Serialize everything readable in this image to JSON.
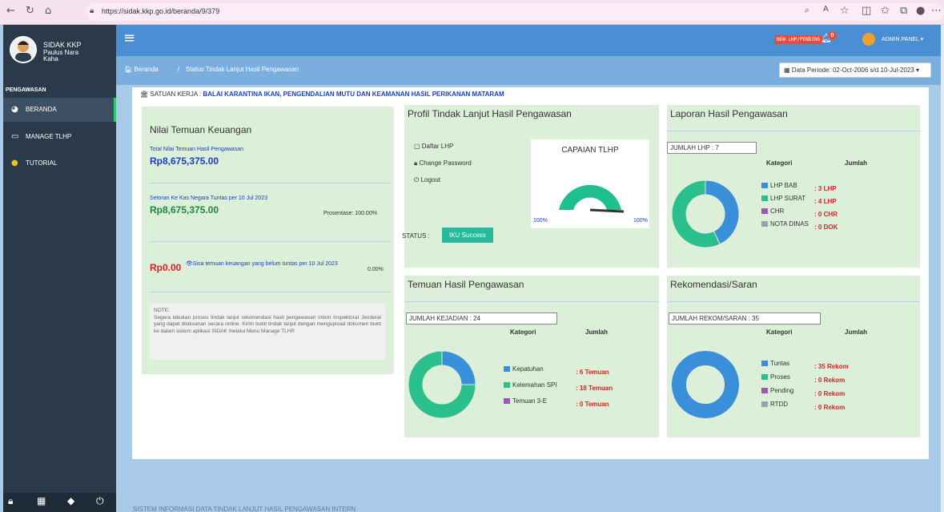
{
  "browser": {
    "url": "https://sidak.kkp.go.id/beranda/9/379"
  },
  "sidebar": {
    "app": "SIDAK KKP",
    "user_line1": "Paulus Nara",
    "user_line2": "Kaha",
    "section": "PENGAWASAN",
    "items": [
      {
        "label": "BERANDA"
      },
      {
        "label": "MANAGE TLHP"
      },
      {
        "label": "TUTORIAL"
      }
    ]
  },
  "topbar": {
    "badge": "NEW LHP/PENDING",
    "notif_count": "0",
    "admin": "ADMIN PANEL"
  },
  "breadcrumb": {
    "home": "Beranda",
    "sep": "/",
    "current": "Status Tindak Lanjut Hasil Pengawasan",
    "period": "Data Periode: 02-Oct-2006 s/d 10-Jul-2023"
  },
  "satuan": {
    "label": "SATUAN KERJA :",
    "value": "BALAI KARANTINA IKAN, PENGENDALIAN MUTU DAN KEAMANAN HASIL PERIKANAN MATARAM"
  },
  "nilai": {
    "title": "Nilai Temuan Keuangan",
    "total_label": "Total Nilai Temuan Hasil Pengawasan",
    "total_value": "Rp8,675,375.00",
    "setoran_label": "Setoran Ke Kas Negara Tuntas per 10 Jul 2023",
    "setoran_value": "Rp8,675,375.00",
    "prosentase": "Prosentase: 100.00%",
    "sisa_value": "Rp0.00",
    "sisa_label": "Sisa temuan keuangan yang belum tuntas per 10 Jul 2023",
    "sisa_pct": "0.00%",
    "note": "NOTE:\nSegera lakukan proses tindak lanjut rekomendasi hasil pengawasan intern Inspektorat Jenderal yang dapat dilaksanan secara online. Kirim bukti tindak lanjut dengan mengupload dokumen bukti ke dalam sistem aplikasi SIDAK melalui Menu Manage TLHP."
  },
  "profil": {
    "title": "Profil Tindak Lanjut Hasil Pengawasan",
    "links": [
      "Daftar LHP",
      "Change Password",
      "Logout"
    ],
    "status_label": "STATUS :",
    "status_value": "IKU Success"
  },
  "capaian": {
    "title": "CAPAIAN TLHP",
    "left": "100%",
    "right": "100%",
    "value": 100
  },
  "laporan": {
    "title": "Laporan Hasil Pengawasan",
    "box": "JUMLAH LHP : 7",
    "col1": "Kategori",
    "col2": "Jumlah",
    "rows": [
      {
        "label": "LHP BAB",
        "value": "3 LHP",
        "color": "#3a8fd9",
        "num": 3
      },
      {
        "label": "LHP SURAT",
        "value": "4 LHP",
        "color": "#2bbf8e",
        "num": 4
      },
      {
        "label": "CHR",
        "value": "0 CHR",
        "color": "#9b59b6",
        "num": 0
      },
      {
        "label": "NOTA DINAS",
        "value": "0 DOK",
        "color": "#95a5a6",
        "num": 0
      }
    ]
  },
  "temuan": {
    "title": "Temuan Hasil Pengawasan",
    "box": "JUMLAH KEJADIAN : 24",
    "col1": "Kategori",
    "col2": "Jumlah",
    "rows": [
      {
        "label": "Kepatuhan",
        "value": "6 Temuan",
        "color": "#3a8fd9",
        "num": 6
      },
      {
        "label": "Kelemahan SPI",
        "value": "18 Temuan",
        "color": "#2bbf8e",
        "num": 18
      },
      {
        "label": "Temuan 3-E",
        "value": "0 Temuan",
        "color": "#9b59b6",
        "num": 0
      }
    ]
  },
  "rekom": {
    "title": "Rekomendasi/Saran",
    "box": "JUMLAH REKOM/SARAN : 35",
    "col1": "Kategori",
    "col2": "Jumlah",
    "rows": [
      {
        "label": "Tuntas",
        "value": "35 Rekom",
        "color": "#3a8fd9",
        "num": 35
      },
      {
        "label": "Proses",
        "value": "0 Rekom",
        "color": "#2bbf8e",
        "num": 0
      },
      {
        "label": "Pending",
        "value": "0 Rekom",
        "color": "#9b59b6",
        "num": 0
      },
      {
        "label": "RTDD",
        "value": "0 Rekom",
        "color": "#95a5a6",
        "num": 0
      }
    ]
  },
  "footer": {
    "text": "SISTEM INFORMASI DATA TINDAK LANJUT HASIL PENGAWASAN INTERN"
  }
}
